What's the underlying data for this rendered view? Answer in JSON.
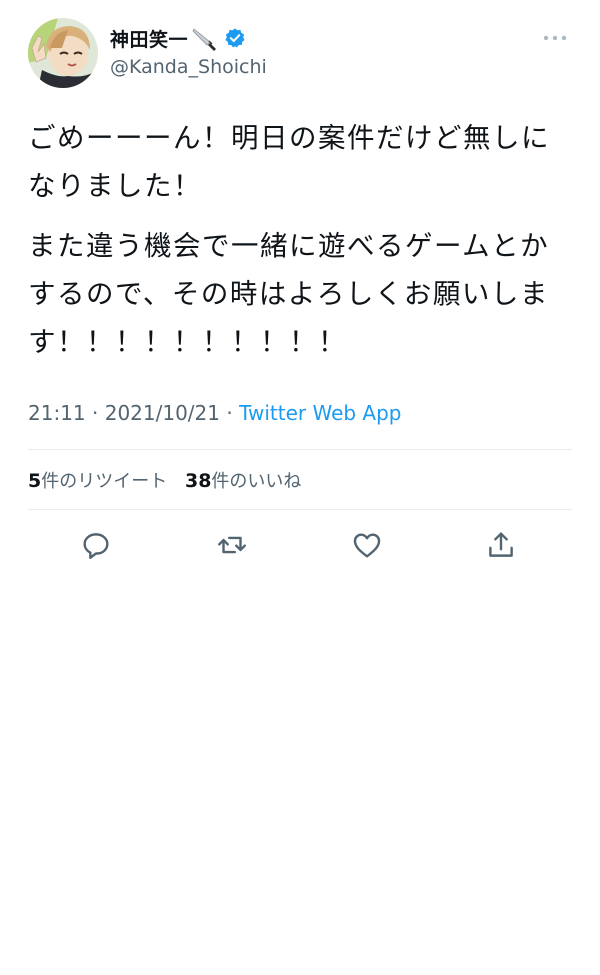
{
  "user": {
    "display_name": "神田笑一",
    "handle": "@Kanda_Shoichi",
    "name_emoji_icon": "knife-icon",
    "verified_icon": "verified-badge-icon",
    "verified_color": "#1d9bf0"
  },
  "tweet": {
    "paragraphs": [
      "ごめーーーん！明日の案件だけど無しになりました！",
      "また違う機会で一緒に遊べるゲームとかするので、その時はよろしくお願いします！！！！！！！！！！"
    ],
    "time": "21:11",
    "date": "2021/10/21",
    "separator": "·",
    "source": "Twitter Web App"
  },
  "stats": {
    "retweets_count": "5",
    "retweets_label": "件のリツイート",
    "likes_count": "38",
    "likes_label": "件のいいね"
  },
  "actions": [
    {
      "icon": "reply-icon"
    },
    {
      "icon": "retweet-icon"
    },
    {
      "icon": "like-icon"
    },
    {
      "icon": "share-icon"
    }
  ],
  "colors": {
    "text": "#0f1419",
    "secondary": "#536471",
    "link": "#1d9bf0",
    "divider": "#e6ecf0"
  }
}
